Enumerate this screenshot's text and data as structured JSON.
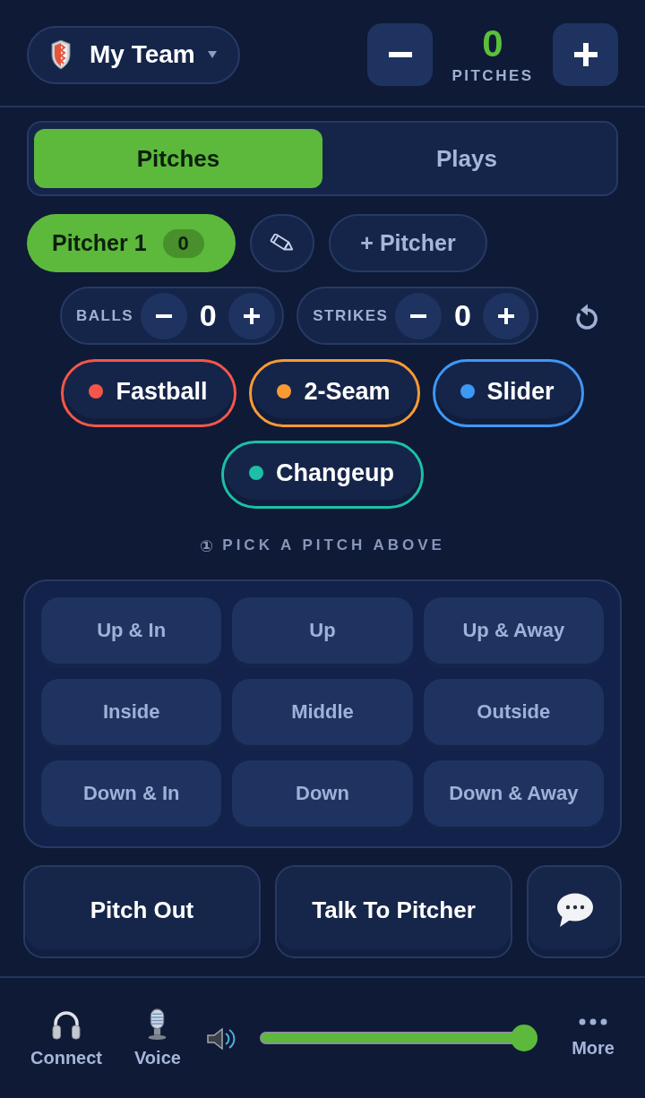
{
  "header": {
    "team_selector": {
      "label": "My Team"
    },
    "pitch_counter": {
      "value": "0",
      "label": "PITCHES"
    }
  },
  "tabs": [
    {
      "label": "Pitches",
      "selected": true
    },
    {
      "label": "Plays",
      "selected": false
    }
  ],
  "pitchers": [
    {
      "label": "Pitcher 1",
      "count": "0",
      "selected": true
    }
  ],
  "add_pitcher_button": "+ Pitcher",
  "count": [
    {
      "label": "BALLS",
      "value": "0"
    },
    {
      "label": "STRIKES",
      "value": "0"
    }
  ],
  "pitch_types": [
    {
      "label": "Fastball",
      "color": "#f5564a",
      "selected": false
    },
    {
      "label": "2-Seam",
      "color": "#f99a33",
      "selected": false
    },
    {
      "label": "Slider",
      "color": "#3e98f6",
      "selected": false
    },
    {
      "label": "Changeup",
      "color": "#1dbfa6",
      "selected": false
    }
  ],
  "hint": {
    "step": "①",
    "text": "PICK A PITCH ABOVE"
  },
  "zones": [
    {
      "label": "Up & In",
      "selected": false
    },
    {
      "label": "Up",
      "selected": false
    },
    {
      "label": "Up & Away",
      "selected": false
    },
    {
      "label": "Inside",
      "selected": false
    },
    {
      "label": "Middle",
      "selected": false
    },
    {
      "label": "Outside",
      "selected": false
    },
    {
      "label": "Down & In",
      "selected": false
    },
    {
      "label": "Down",
      "selected": false
    },
    {
      "label": "Down & Away",
      "selected": false
    }
  ],
  "actions": [
    "Pitch Out",
    "Talk To Pitcher"
  ],
  "bottom_bar": {
    "items": [
      {
        "label": "Connect",
        "kind": "headset"
      },
      {
        "label": "Voice",
        "kind": "mic"
      }
    ],
    "volume": {
      "level": 1
    },
    "more": "More"
  }
}
